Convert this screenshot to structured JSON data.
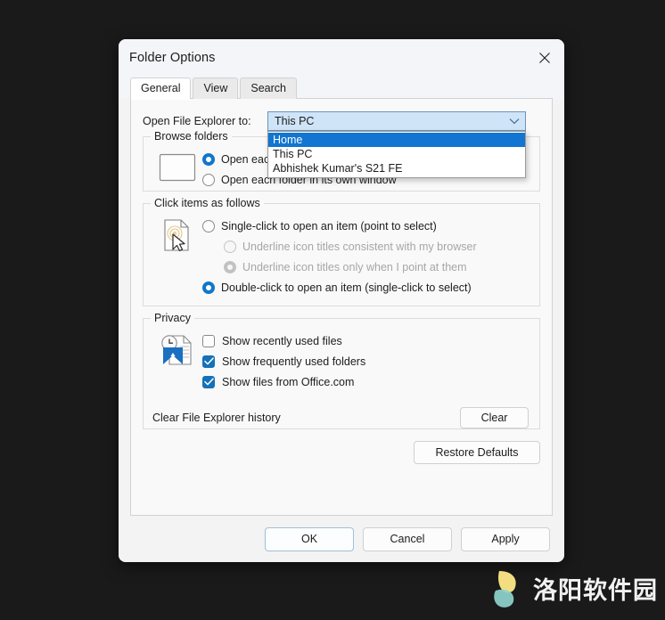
{
  "window": {
    "title": "Folder Options",
    "close_icon": "close-icon"
  },
  "tabs": [
    {
      "label": "General",
      "active": true
    },
    {
      "label": "View",
      "active": false
    },
    {
      "label": "Search",
      "active": false
    }
  ],
  "explorer": {
    "label": "Open File Explorer to:",
    "selected_value": "This PC",
    "chevron_icon": "chevron-down-icon",
    "options": [
      {
        "label": "Home",
        "highlighted": true
      },
      {
        "label": "This PC",
        "highlighted": false
      },
      {
        "label": "Abhishek Kumar's S21 FE",
        "highlighted": false
      }
    ]
  },
  "browse_folders": {
    "legend": "Browse folders",
    "icon": "folder-window-icon",
    "options": [
      {
        "label": "Open each folder in the same window",
        "checked": true
      },
      {
        "label": "Open each folder in its own window",
        "checked": false
      }
    ]
  },
  "click_items": {
    "legend": "Click items as follows",
    "icon": "document-pointer-icon",
    "options": [
      {
        "label": "Single-click to open an item (point to select)",
        "checked": false,
        "disabled": false,
        "indent": false
      },
      {
        "label": "Underline icon titles consistent with my browser",
        "checked": false,
        "disabled": true,
        "indent": true
      },
      {
        "label": "Underline icon titles only when I point at them",
        "checked": true,
        "disabled": true,
        "indent": true
      },
      {
        "label": "Double-click to open an item (single-click to select)",
        "checked": true,
        "disabled": false,
        "indent": false
      }
    ]
  },
  "privacy": {
    "legend": "Privacy",
    "icon": "recent-files-icon",
    "checkboxes": [
      {
        "label": "Show recently used files",
        "checked": false
      },
      {
        "label": "Show frequently used folders",
        "checked": true
      },
      {
        "label": "Show files from Office.com",
        "checked": true
      }
    ],
    "clear_history_label": "Clear File Explorer history",
    "clear_button_label": "Clear"
  },
  "restore_defaults_label": "Restore Defaults",
  "footer": {
    "ok_label": "OK",
    "cancel_label": "Cancel",
    "apply_label": "Apply"
  },
  "watermark": {
    "text": "洛阳软件园"
  },
  "colors": {
    "accent_blue": "#1175d1",
    "checkbox_blue": "#1571b8",
    "radio_blue": "#1376c8",
    "combo_fill": "#cfe4f7",
    "desktop_background": "#1a1a1a"
  }
}
